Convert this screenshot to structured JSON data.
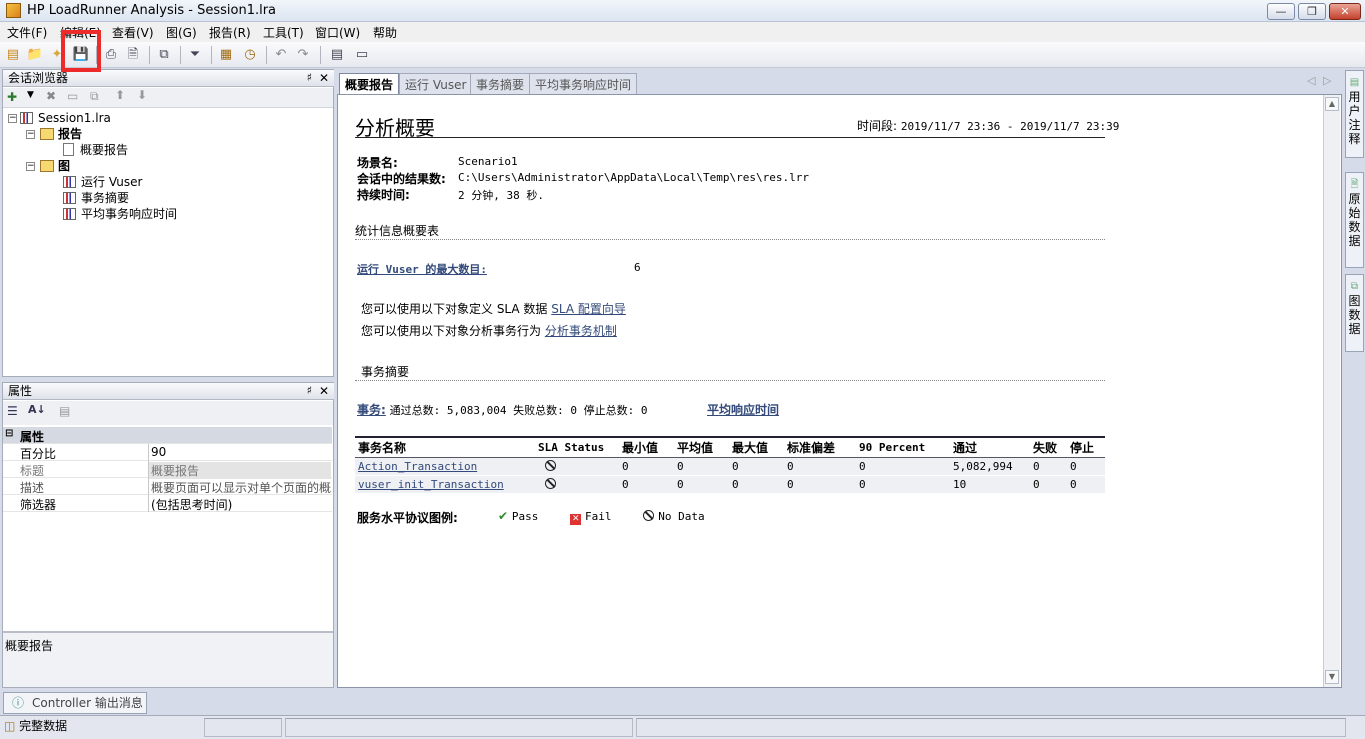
{
  "window": {
    "title": "HP LoadRunner Analysis - Session1.lra"
  },
  "menu": [
    "文件(F)",
    "编辑(E)",
    "查看(V)",
    "图(G)",
    "报告(R)",
    "工具(T)",
    "窗口(W)",
    "帮助"
  ],
  "session_browser": {
    "title": "会话浏览器",
    "root": "Session1.lra",
    "folders": [
      {
        "label": "报告",
        "items": [
          "概要报告"
        ]
      },
      {
        "label": "图",
        "items": [
          "运行 Vuser",
          "事务摘要",
          "平均事务响应时间"
        ]
      }
    ]
  },
  "properties": {
    "title": "属性",
    "group": "属性",
    "rows": [
      {
        "key": "百分比",
        "value": "90"
      },
      {
        "key": "标题",
        "value": "概要报告"
      },
      {
        "key": "描述",
        "value": "概要页面可以显示对单个页面的概"
      },
      {
        "key": "筛选器",
        "value": "(包括思考时间)"
      }
    ],
    "description": "概要报告"
  },
  "tabs": [
    "概要报告",
    "运行 Vuser",
    "事务摘要",
    "平均事务响应时间"
  ],
  "report": {
    "heading": "分析概要",
    "period_label": "时间段:",
    "period_value": "2019/11/7 23:36 - 2019/11/7 23:39",
    "scenario_label": "场景名:",
    "scenario_value": "Scenario1",
    "results_label": "会话中的结果数:",
    "results_value": "C:\\Users\\Administrator\\AppData\\Local\\Temp\\res\\res.lrr",
    "duration_label": "持续时间:",
    "duration_value": "2 分钟, 38 秒.",
    "stats_title": "统计信息概要表",
    "max_vuser_label": "运行 Vuser 的最大数目:",
    "max_vuser_value": "6",
    "sla_line_prefix": "您可以使用以下对象定义 SLA 数据",
    "sla_link": "SLA 配置向导",
    "analyze_line_prefix": "您可以使用以下对象分析事务行为",
    "analyze_link": "分析事务机制",
    "tx_section_title": "事务摘要",
    "tx_label": "事务:",
    "tx_counts": "通过总数: 5,083,004 失败总数: 0 停止总数: 0",
    "avg_resp_link": "平均响应时间",
    "table": {
      "columns": [
        "事务名称",
        "SLA Status",
        "最小值",
        "平均值",
        "最大值",
        "标准偏差",
        "90 Percent",
        "通过",
        "失败",
        "停止"
      ],
      "rows": [
        {
          "name": "Action_Transaction",
          "min": "0",
          "avg": "0",
          "max": "0",
          "std": "0",
          "p90": "0",
          "pass": "5,082,994",
          "fail": "0",
          "stop": "0"
        },
        {
          "name": "vuser_init_Transaction",
          "min": "0",
          "avg": "0",
          "max": "0",
          "std": "0",
          "p90": "0",
          "pass": "10",
          "fail": "0",
          "stop": "0"
        }
      ]
    },
    "legend_label": "服务水平协议图例:",
    "legend_pass": "Pass",
    "legend_fail": "Fail",
    "legend_nodata": "No Data"
  },
  "right_tabs": [
    "用户注释",
    "原始数据",
    "图数据"
  ],
  "output_tab": "Controller 输出消息",
  "status": {
    "text": "完整数据"
  }
}
